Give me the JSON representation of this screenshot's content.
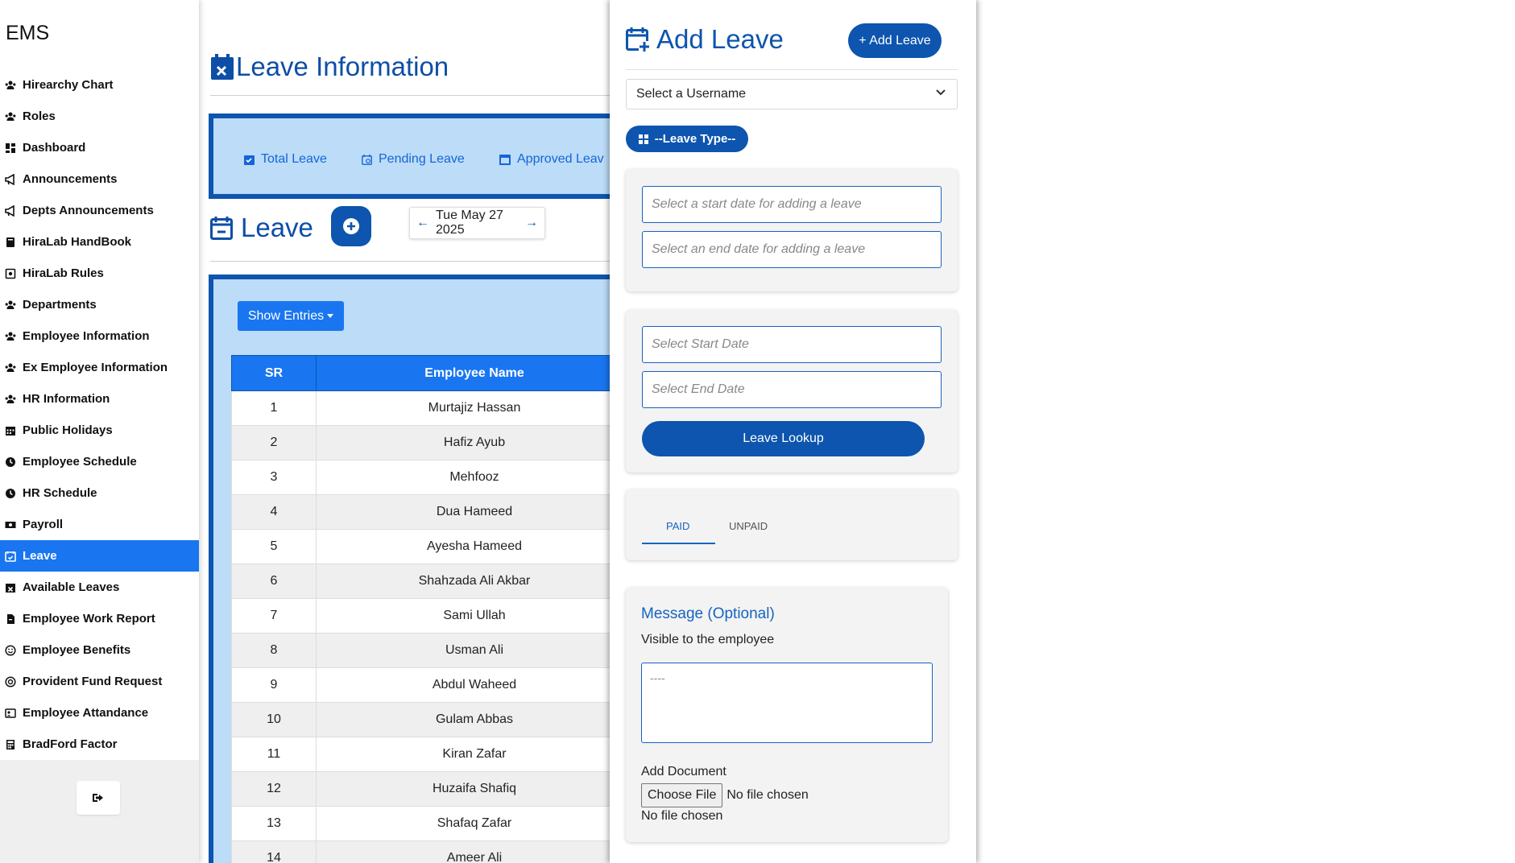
{
  "sidebar": {
    "brand": "EMS",
    "items": [
      {
        "label": "Hirearchy Chart",
        "icon": "users-icon"
      },
      {
        "label": "Roles",
        "icon": "users-icon"
      },
      {
        "label": "Dashboard",
        "icon": "dashboard-icon"
      },
      {
        "label": "Announcements",
        "icon": "megaphone-icon"
      },
      {
        "label": "Depts Announcements",
        "icon": "megaphone-icon"
      },
      {
        "label": "HiraLab HandBook",
        "icon": "book-icon"
      },
      {
        "label": "HiraLab Rules",
        "icon": "rules-icon"
      },
      {
        "label": "Departments",
        "icon": "users-icon"
      },
      {
        "label": "Employee Information",
        "icon": "users-icon"
      },
      {
        "label": "Ex Employee Information",
        "icon": "users-icon"
      },
      {
        "label": "HR Information",
        "icon": "users-icon"
      },
      {
        "label": "Public Holidays",
        "icon": "calendar-icon"
      },
      {
        "label": "Employee Schedule",
        "icon": "clock-icon"
      },
      {
        "label": "HR Schedule",
        "icon": "clock-icon"
      },
      {
        "label": "Payroll",
        "icon": "money-icon"
      },
      {
        "label": "Leave",
        "icon": "calendar-check-icon"
      },
      {
        "label": "Available Leaves",
        "icon": "calendar-x-icon"
      },
      {
        "label": "Employee Work Report",
        "icon": "file-icon"
      },
      {
        "label": "Employee Benefits",
        "icon": "smile-icon"
      },
      {
        "label": "Provident Fund Request",
        "icon": "coin-icon"
      },
      {
        "label": "Employee Attandance",
        "icon": "id-card-icon"
      },
      {
        "label": "BradFord Factor",
        "icon": "calculator-icon"
      }
    ],
    "active_index": 15
  },
  "main": {
    "title": "Leave Information",
    "stats": {
      "total": "Total Leave",
      "pending": "Pending Leave",
      "approved": "Approved Leav"
    },
    "leave_title": "Leave",
    "date": "Tue May 27 2025",
    "show_entries": "Show Entries",
    "table": {
      "headers": [
        "SR",
        "Employee Name"
      ],
      "rows": [
        [
          "1",
          "Murtajiz Hassan"
        ],
        [
          "2",
          "Hafiz Ayub"
        ],
        [
          "3",
          "Mehfooz"
        ],
        [
          "4",
          "Dua Hameed"
        ],
        [
          "5",
          "Ayesha Hameed"
        ],
        [
          "6",
          "Shahzada Ali Akbar"
        ],
        [
          "7",
          "Sami Ullah"
        ],
        [
          "8",
          "Usman Ali"
        ],
        [
          "9",
          "Abdul Waheed"
        ],
        [
          "10",
          "Gulam Abbas"
        ],
        [
          "11",
          "Kiran Zafar"
        ],
        [
          "12",
          "Huzaifa Shafiq"
        ],
        [
          "13",
          "Shafaq Zafar"
        ],
        [
          "14",
          "Ameer Ali"
        ]
      ]
    }
  },
  "panel": {
    "title": "Add Leave",
    "add_button": "+ Add Leave",
    "select_username": "Select a Username",
    "leave_type": "--Leave Type--",
    "start_date_placeholder": "Select a start date for adding a leave",
    "end_date_placeholder": "Select an end date for adding a leave",
    "lookup_start_placeholder": "Select Start Date",
    "lookup_end_placeholder": "Select End Date",
    "lookup_button": "Leave Lookup",
    "tabs": [
      "PAID",
      "UNPAID"
    ],
    "message_title": "Message (Optional)",
    "message_subtitle": "Visible to the employee",
    "message_placeholder": "----",
    "add_document": "Add Document",
    "choose_file": "Choose File",
    "no_file_inline": "No file chosen",
    "no_file_status": "No file chosen"
  },
  "colors": {
    "primary": "#0d55ae",
    "accent": "#1976f0",
    "light_blue": "#bcdcf7"
  }
}
